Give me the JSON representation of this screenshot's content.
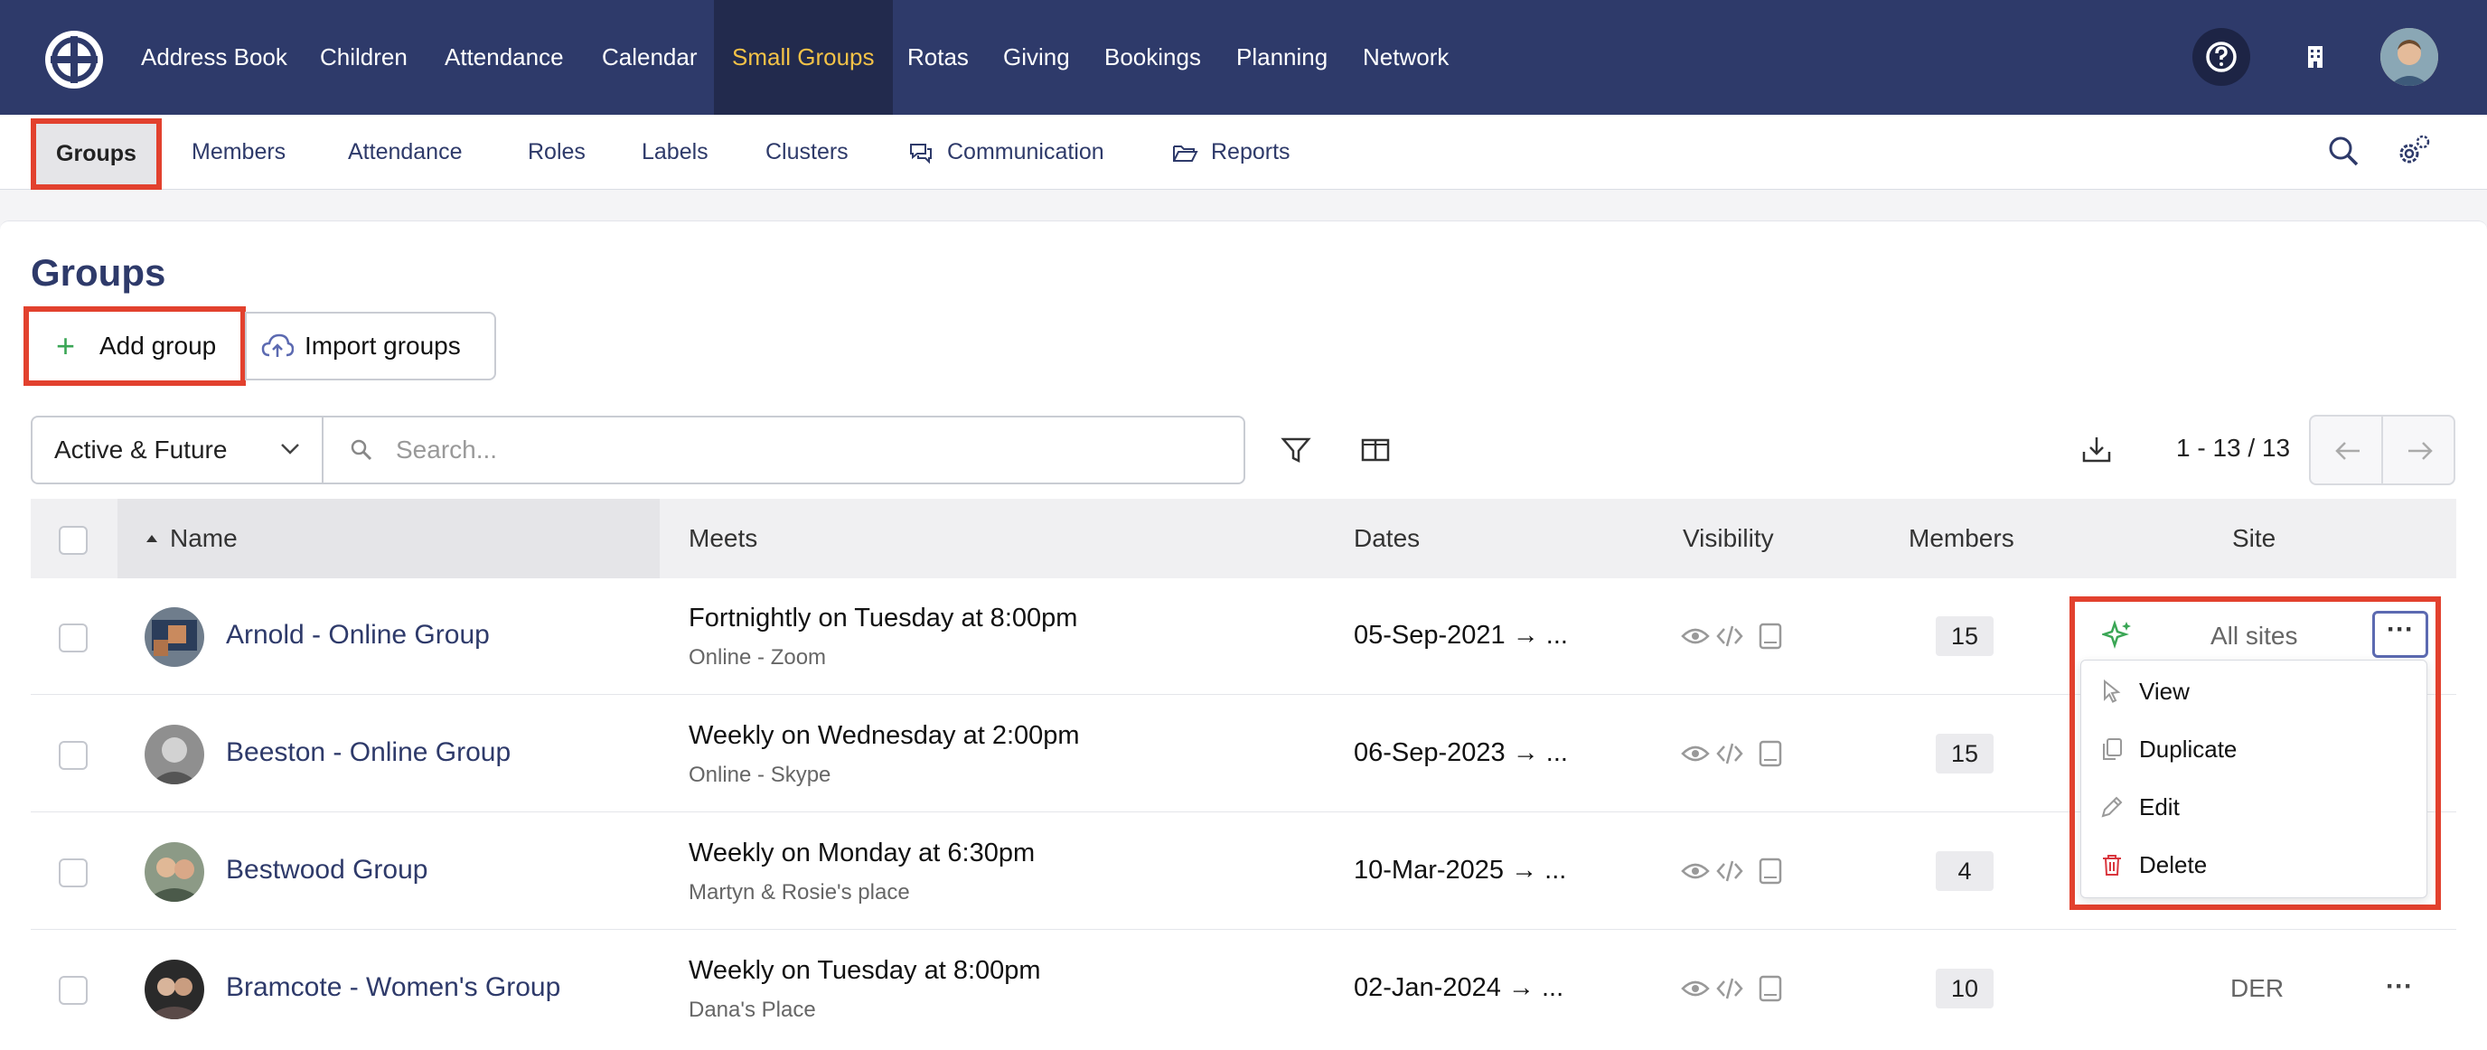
{
  "topnav": {
    "items": [
      "Address Book",
      "Children",
      "Attendance",
      "Calendar",
      "Small Groups",
      "Rotas",
      "Giving",
      "Bookings",
      "Planning",
      "Network"
    ],
    "active": "Small Groups",
    "icons": [
      "logo-icon",
      "help-icon",
      "building-icon",
      "user-avatar"
    ]
  },
  "subnav": {
    "items": [
      "Groups",
      "Members",
      "Attendance",
      "Roles",
      "Labels",
      "Clusters",
      "Communication",
      "Reports"
    ],
    "active": "Groups"
  },
  "page": {
    "title": "Groups",
    "add_label": "Add group",
    "import_label": "Import groups"
  },
  "toolbar": {
    "filter_value": "Active & Future",
    "search_placeholder": "Search...",
    "pager_text": "1 - 13 / 13"
  },
  "table": {
    "columns": [
      "Name",
      "Meets",
      "Dates",
      "Visibility",
      "Members",
      "Site"
    ],
    "rows": [
      {
        "name": "Arnold - Online Group",
        "meets": "Fortnightly on Tuesday at 8:00pm",
        "place": "Online - Zoom",
        "date": "05-Sep-2021",
        "members": "15",
        "site": "All sites"
      },
      {
        "name": "Beeston - Online Group",
        "meets": "Weekly on Wednesday at 2:00pm",
        "place": "Online - Skype",
        "date": "06-Sep-2023",
        "members": "15",
        "site": ""
      },
      {
        "name": "Bestwood Group",
        "meets": "Weekly on Monday at 6:30pm",
        "place": "Martyn & Rosie's place",
        "date": "10-Mar-2025",
        "members": "4",
        "site": ""
      },
      {
        "name": "Bramcote - Women's Group",
        "meets": "Weekly on Tuesday at 8:00pm",
        "place": "Dana's Place",
        "date": "02-Jan-2024",
        "members": "10",
        "site": "DER"
      }
    ],
    "date_suffix": "→ ..."
  },
  "row_menu": {
    "items": [
      "View",
      "Duplicate",
      "Edit",
      "Delete"
    ],
    "delete_color": "#d9363e"
  },
  "colors": {
    "nav_bg": "#2e3a6a",
    "active_nav": "#f3c247",
    "highlight": "#e2412e",
    "link": "#2e3a6a"
  }
}
